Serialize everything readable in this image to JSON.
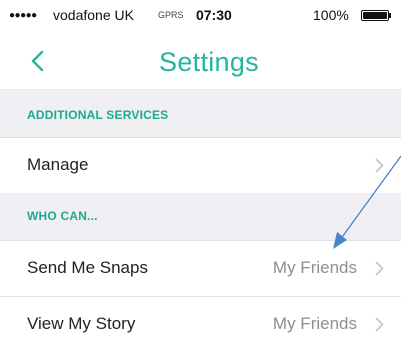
{
  "status_bar": {
    "signal": "●●●●●",
    "carrier": "vodafone UK",
    "network": "GPRS",
    "time": "07:30",
    "battery_percent": "100%",
    "battery_level": 1.0
  },
  "nav": {
    "back_icon": "chevron-left-icon",
    "title": "Settings"
  },
  "sections": [
    {
      "header": "ADDITIONAL SERVICES",
      "rows": [
        {
          "label": "Manage",
          "value": ""
        }
      ]
    },
    {
      "header": "WHO CAN...",
      "rows": [
        {
          "label": "Send Me Snaps",
          "value": "My Friends"
        },
        {
          "label": "View My Story",
          "value": "My Friends"
        }
      ]
    }
  ],
  "colors": {
    "accent": "#24b59a",
    "section_bg": "#efeff4",
    "annotation_arrow": "#4a86c8"
  }
}
